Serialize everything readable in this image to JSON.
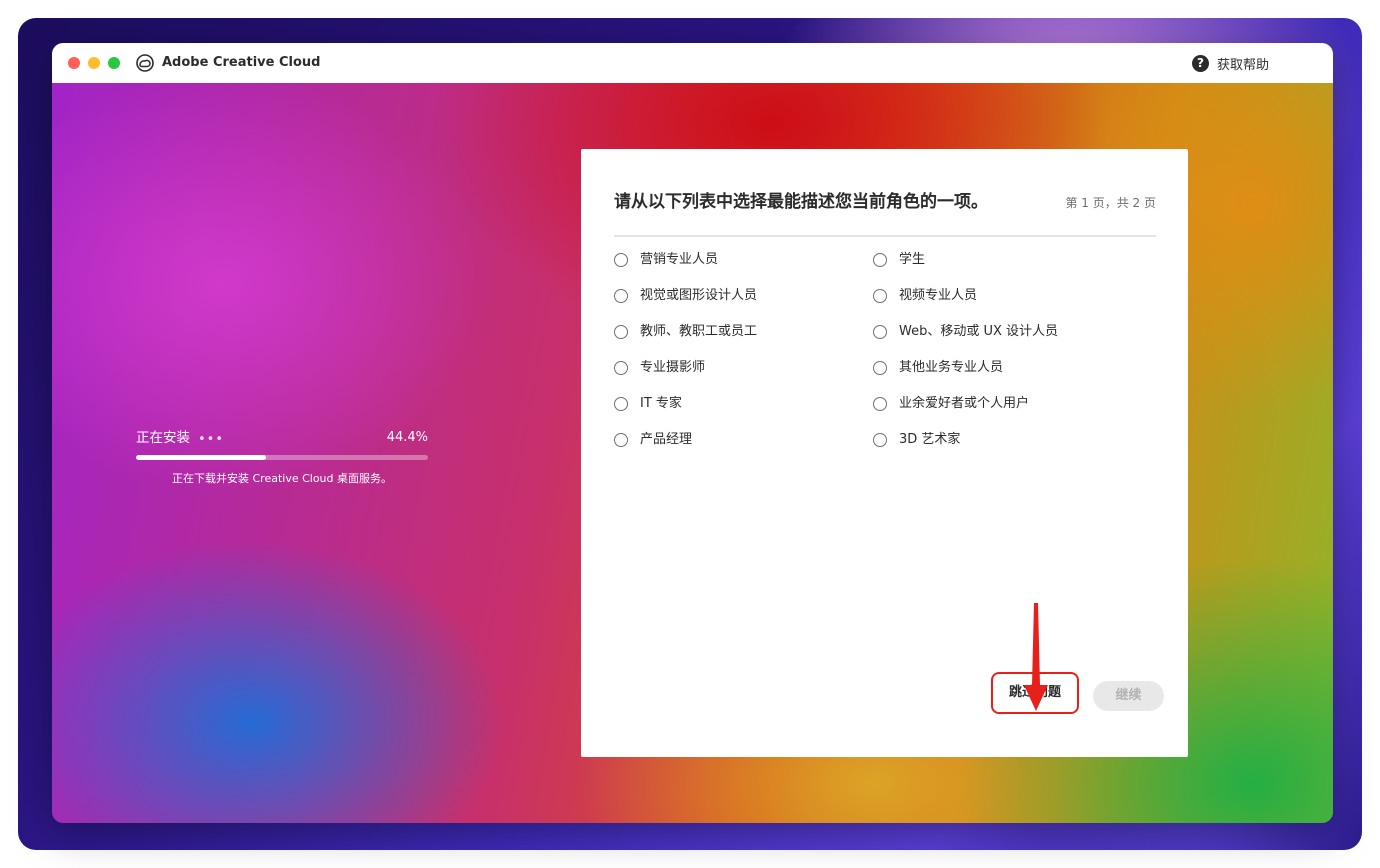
{
  "window": {
    "title": "Adobe Creative Cloud",
    "help_label": "获取帮助",
    "traffic_lights": [
      "close",
      "minimize",
      "zoom"
    ]
  },
  "install": {
    "status": "正在安装",
    "dots": "•••",
    "percent_label": "44.4%",
    "progress_fraction": 0.444,
    "description": "正在下载并安装 Creative Cloud 桌面服务。"
  },
  "survey": {
    "heading": "请从以下列表中选择最能描述您当前角色的一项。",
    "page_indicator": "第 1 页，共 2 页",
    "options_left": [
      "营销专业人员",
      "视觉或图形设计人员",
      "教师、教职工或员工",
      "专业摄影师",
      "IT 专家",
      "产品经理"
    ],
    "options_right": [
      "学生",
      "视频专业人员",
      "Web、移动或 UX 设计人员",
      "其他业务专业人员",
      "业余爱好者或个人用户",
      "3D 艺术家"
    ],
    "skip_label": "跳过问题",
    "continue_label": "继续"
  },
  "colors": {
    "accent_highlight": "#e8201a",
    "text_primary": "#2c2c2c",
    "text_secondary": "#6e6e6e",
    "disabled_bg": "#e8e8e8",
    "disabled_text": "#b3b3b3"
  },
  "icons": {
    "app_logo": "creative-cloud-icon",
    "help": "question-circle-icon",
    "annotation": "red-arrow-down-icon"
  }
}
